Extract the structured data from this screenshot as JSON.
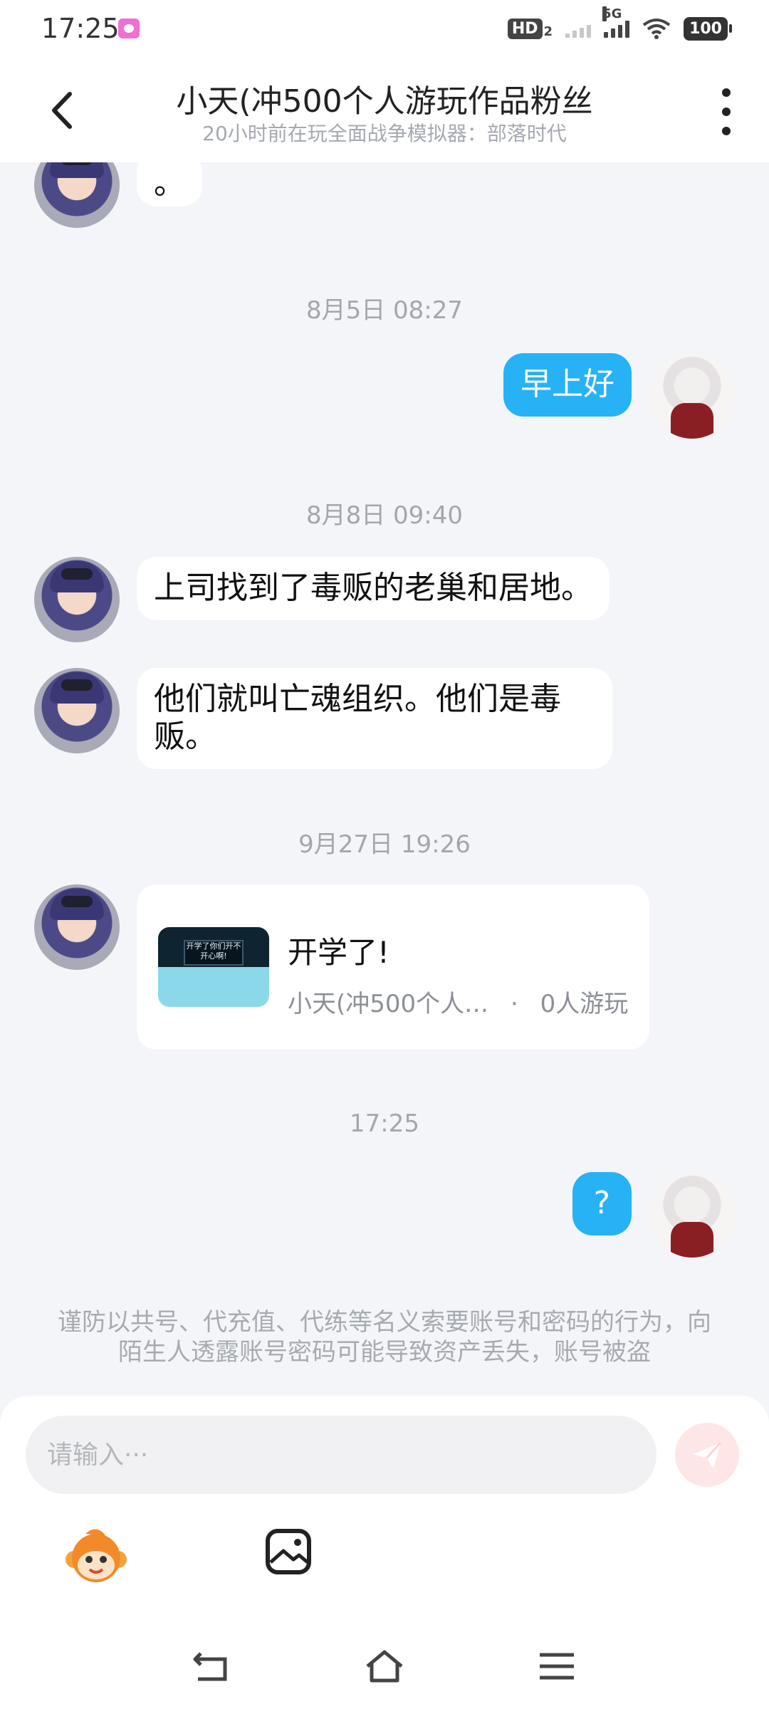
{
  "status_bar": {
    "time": "17:25",
    "hd_label": "HD",
    "hd_sub": "2",
    "net_label": "5G",
    "battery": "100"
  },
  "header": {
    "title": "小天(冲500个人游玩作品粉丝",
    "subtitle": "20小时前在玩全面战争模拟器：部落时代"
  },
  "messages": [
    {
      "type": "text",
      "from": "friend",
      "text": "。"
    },
    {
      "type": "time",
      "text": "8月5日 08:27"
    },
    {
      "type": "text",
      "from": "self",
      "text": "早上好"
    },
    {
      "type": "time",
      "text": "8月8日 09:40"
    },
    {
      "type": "text",
      "from": "friend",
      "text": "上司找到了毒贩的老巢和居地。"
    },
    {
      "type": "text",
      "from": "friend",
      "text": "他们就叫亡魂组织。他们是毒贩。"
    },
    {
      "type": "time",
      "text": "9月27日 19:26"
    },
    {
      "type": "card",
      "from": "friend",
      "title": "开学了!",
      "author": "小天(冲500个人…",
      "plays": "0人游玩",
      "thumb_text": "开学了你们开不开心啊!"
    },
    {
      "type": "time",
      "text": "17:25"
    },
    {
      "type": "text",
      "from": "self",
      "text": "?"
    }
  ],
  "warning": "谨防以共号、代充值、代练等名义索要账号和密码的行为，向陌生人透露账号密码可能导致资产丢失，账号被盗",
  "composer": {
    "placeholder": "请输入···"
  },
  "icons": {
    "back": "back-arrow-icon",
    "more": "more-vertical-icon",
    "send": "paper-plane-icon",
    "emoji": "monkey-emoji-icon",
    "image": "image-icon"
  },
  "colors": {
    "self_bubble": "#27b2f6",
    "background": "#f3f5f8",
    "send_button": "#ffe6e6"
  }
}
